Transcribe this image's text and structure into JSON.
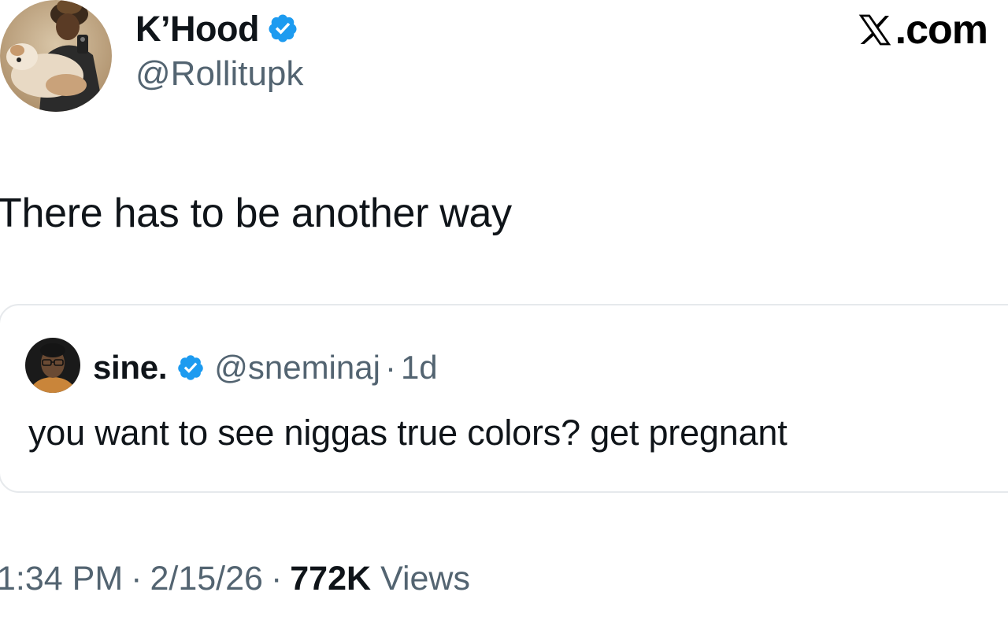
{
  "brand": {
    "label": ".com",
    "icon": "x-logo-icon"
  },
  "author": {
    "name": "K’Hood",
    "handle": "@Rollitupk",
    "verified": true,
    "avatar_icon": "avatar-photo"
  },
  "tweet": {
    "text": "There has to be another way"
  },
  "quote": {
    "name": "sine.",
    "handle": "@sneminaj",
    "separator": "·",
    "age": "1d",
    "verified": true,
    "text": "you want to see niggas true colors? get pregnant",
    "avatar_icon": "avatar-photo"
  },
  "meta": {
    "time": "1:34 PM",
    "separator": "·",
    "date": "2/15/26",
    "views_count": "772K",
    "views_label": "Views"
  },
  "colors": {
    "verified_blue": "#1d9bf0",
    "secondary_text": "#536471",
    "primary_text": "#0f1419",
    "border": "#e6e9ec"
  }
}
